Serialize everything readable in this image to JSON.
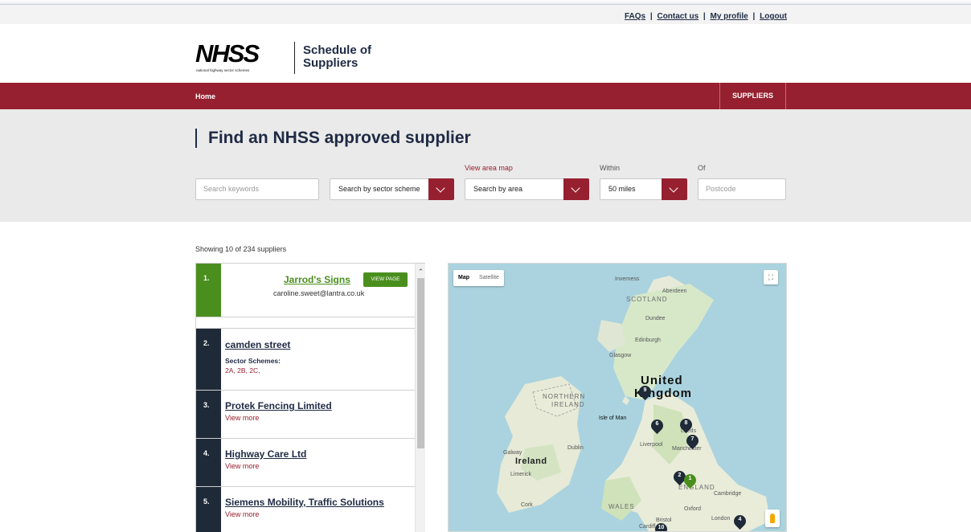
{
  "util_links": {
    "faqs": "FAQs",
    "contact": "Contact us",
    "profile": "My profile",
    "logout": "Logout",
    "sep": "|"
  },
  "brand": {
    "logo_text": "NHSS",
    "logo_sub": "national highway sector schemes",
    "title": "Schedule of Suppliers"
  },
  "nav": {
    "home": "Home",
    "suppliers": "SUPPLIERS"
  },
  "search": {
    "title": "Find an NHSS approved supplier",
    "keywords_placeholder": "Search keywords",
    "sector_select": "Search by sector scheme",
    "view_area_map": "View area map",
    "area_select": "Search by area",
    "within_label": "Within",
    "within_select": "50 miles",
    "of_label": "Of",
    "postcode_placeholder": "Postcode"
  },
  "results": {
    "showing": "Showing 10 of 234 suppliers",
    "items": [
      {
        "num": "1.",
        "name": "Jarrod's Signs",
        "button": "VIEW PAGE",
        "email": "caroline.sweet@lantra.co.uk"
      },
      {
        "num": "2.",
        "name": "camden street",
        "sector_label": "Sector Schemes:",
        "sector_codes": "2A, 2B, 2C,"
      },
      {
        "num": "3.",
        "name": "Protek Fencing Limited",
        "more": "View more"
      },
      {
        "num": "4.",
        "name": "Highway Care Ltd",
        "more": "View more"
      },
      {
        "num": "5.",
        "name": "Siemens Mobility, Traffic Solutions",
        "more": "View more"
      }
    ]
  },
  "map": {
    "toggle_map": "Map",
    "toggle_satellite": "Satellite",
    "labels": {
      "inverness": "Inverness",
      "aberdeen": "Aberdeen",
      "scotland": "SCOTLAND",
      "dundee": "Dundee",
      "edinburgh": "Edinburgh",
      "glasgow": "Glasgow",
      "united": "United",
      "kingdom": "Kingdom",
      "northern": "NORTHERN",
      "ireland_ni": "IRELAND",
      "isle_of_man": "Isle of Man",
      "leeds": "Leeds",
      "liverpool": "Liverpool",
      "manchester": "Manchester",
      "galway": "Galway",
      "dublin": "Dublin",
      "ireland": "Ireland",
      "limerick": "Limerick",
      "england": "ENGLAND",
      "cambridge": "Cambridge",
      "cork": "Cork",
      "wales": "WALES",
      "oxford": "Oxford",
      "bristol": "Bristol",
      "london": "London",
      "cardiff": "Cardiff"
    },
    "pins": [
      {
        "label": "1",
        "color": "#4a8f1e"
      },
      {
        "label": "2",
        "color": "#1f2a38"
      },
      {
        "label": "4",
        "color": "#1f2a38"
      },
      {
        "label": "6",
        "color": "#1f2a38"
      },
      {
        "label": "7",
        "color": "#1f2a38"
      },
      {
        "label": "8",
        "color": "#1f2a38"
      },
      {
        "label": "9",
        "color": "#1f2a38"
      },
      {
        "label": "10",
        "color": "#1f2a38"
      }
    ]
  },
  "colors": {
    "brand_red": "#96202f",
    "brand_green": "#4a8f1e",
    "navy": "#1f2a38"
  }
}
